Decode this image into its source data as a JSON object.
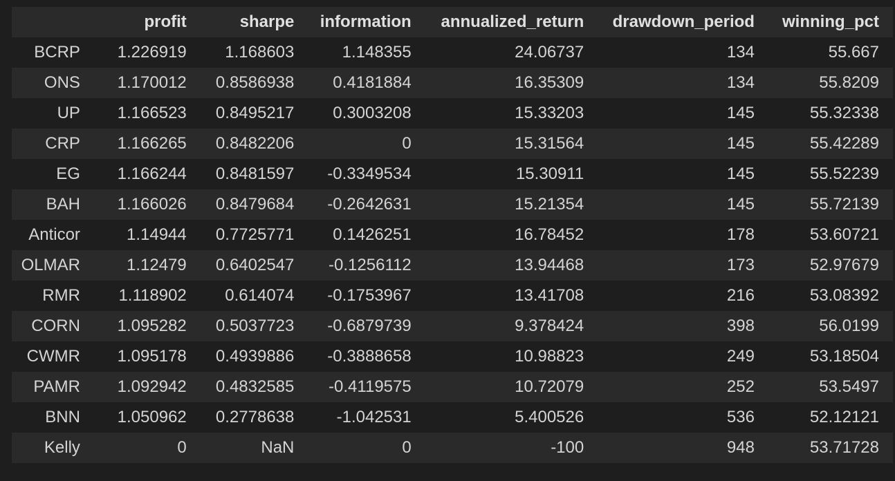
{
  "table": {
    "index_header": "",
    "columns": [
      "profit",
      "sharpe",
      "information",
      "annualized_return",
      "drawdown_period",
      "winning_pct"
    ],
    "rows": [
      {
        "name": "BCRP",
        "values": [
          "1.226919",
          "1.168603",
          "1.148355",
          "24.06737",
          "134",
          "55.667"
        ]
      },
      {
        "name": "ONS",
        "values": [
          "1.170012",
          "0.8586938",
          "0.4181884",
          "16.35309",
          "134",
          "55.8209"
        ]
      },
      {
        "name": "UP",
        "values": [
          "1.166523",
          "0.8495217",
          "0.3003208",
          "15.33203",
          "145",
          "55.32338"
        ]
      },
      {
        "name": "CRP",
        "values": [
          "1.166265",
          "0.8482206",
          "0",
          "15.31564",
          "145",
          "55.42289"
        ]
      },
      {
        "name": "EG",
        "values": [
          "1.166244",
          "0.8481597",
          "-0.3349534",
          "15.30911",
          "145",
          "55.52239"
        ]
      },
      {
        "name": "BAH",
        "values": [
          "1.166026",
          "0.8479684",
          "-0.2642631",
          "15.21354",
          "145",
          "55.72139"
        ]
      },
      {
        "name": "Anticor",
        "values": [
          "1.14944",
          "0.7725771",
          "0.1426251",
          "16.78452",
          "178",
          "53.60721"
        ]
      },
      {
        "name": "OLMAR",
        "values": [
          "1.12479",
          "0.6402547",
          "-0.1256112",
          "13.94468",
          "173",
          "52.97679"
        ]
      },
      {
        "name": "RMR",
        "values": [
          "1.118902",
          "0.614074",
          "-0.1753967",
          "13.41708",
          "216",
          "53.08392"
        ]
      },
      {
        "name": "CORN",
        "values": [
          "1.095282",
          "0.5037723",
          "-0.6879739",
          "9.378424",
          "398",
          "56.0199"
        ]
      },
      {
        "name": "CWMR",
        "values": [
          "1.095178",
          "0.4939886",
          "-0.3888658",
          "10.98823",
          "249",
          "53.18504"
        ]
      },
      {
        "name": "PAMR",
        "values": [
          "1.092942",
          "0.4832585",
          "-0.4119575",
          "10.72079",
          "252",
          "53.5497"
        ]
      },
      {
        "name": "BNN",
        "values": [
          "1.050962",
          "0.2778638",
          "-1.042531",
          "5.400526",
          "536",
          "52.12121"
        ]
      },
      {
        "name": "Kelly",
        "values": [
          "0",
          "NaN",
          "0",
          "-100",
          "948",
          "53.71728"
        ]
      }
    ]
  },
  "colors": {
    "background": "#1e1e1e",
    "stripe": "#2a2a2a",
    "text": "#d4d4d4"
  }
}
